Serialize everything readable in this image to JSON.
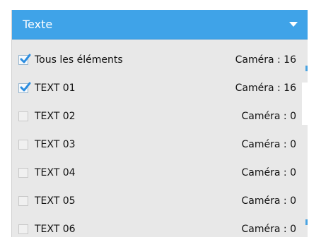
{
  "header": {
    "title": "Texte",
    "arrow_icon": "chevron-down-icon"
  },
  "items": [
    {
      "label": "Tous les éléments",
      "count": "Caméra : 16",
      "checked": true
    },
    {
      "label": "TEXT 01",
      "count": "Caméra : 16",
      "checked": true
    },
    {
      "label": "TEXT 02",
      "count": "Caméra : 0",
      "checked": false
    },
    {
      "label": "TEXT 03",
      "count": "Caméra : 0",
      "checked": false
    },
    {
      "label": "TEXT 04",
      "count": "Caméra : 0",
      "checked": false
    },
    {
      "label": "TEXT 05",
      "count": "Caméra : 0",
      "checked": false
    },
    {
      "label": "TEXT 06",
      "count": "Caméra : 0",
      "checked": false
    }
  ],
  "colors": {
    "header": "#3fa3e8",
    "panel": "#e8e8e8",
    "check": "#2b8de0"
  }
}
